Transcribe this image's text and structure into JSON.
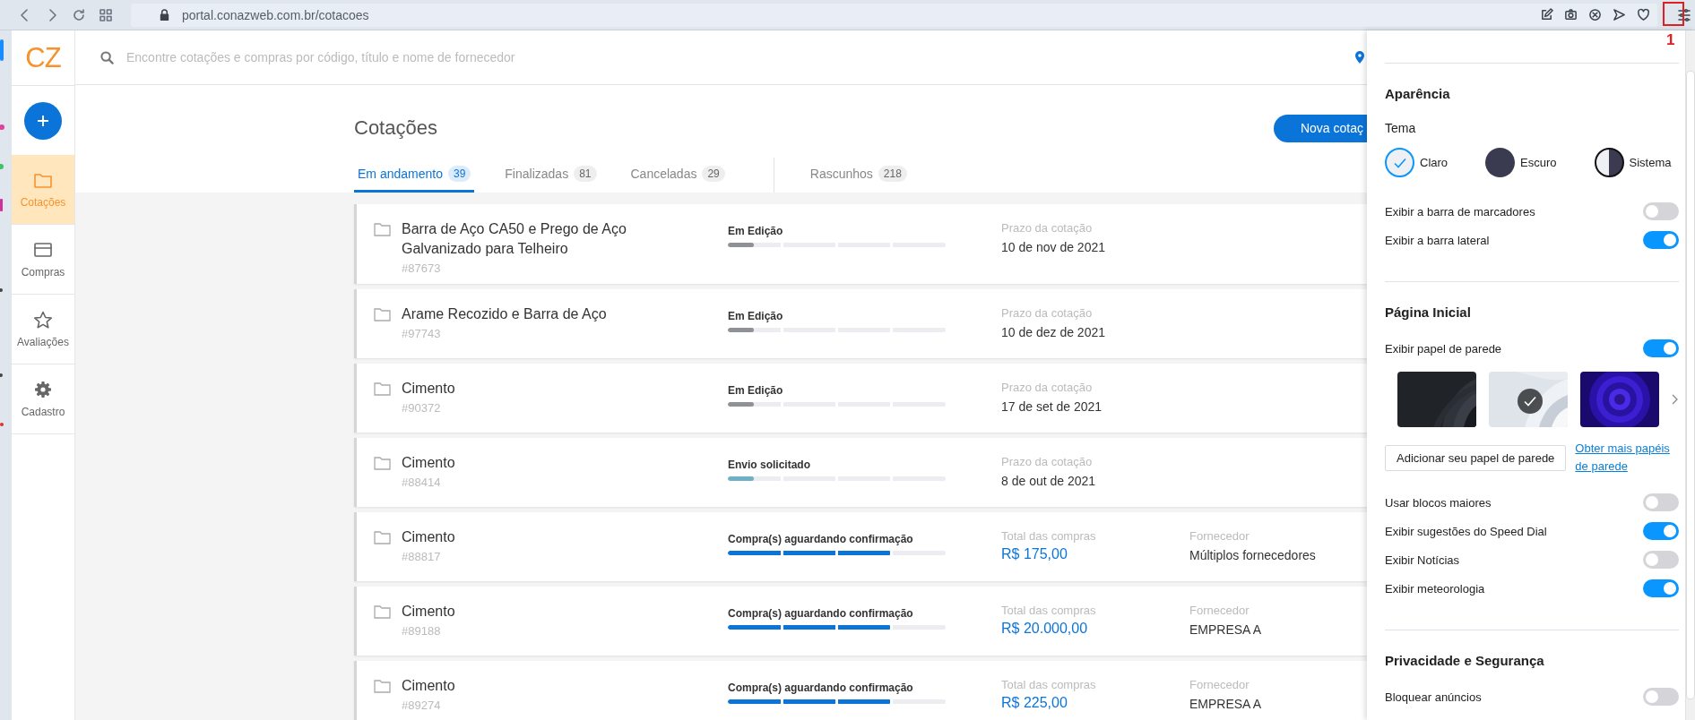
{
  "browser": {
    "url": "portal.conazweb.com.br/cotacoes"
  },
  "annotation": {
    "label": "1"
  },
  "app": {
    "logo": "CZ",
    "search": {
      "placeholder": "Encontre cotações e compras por código, título e nome de fornecedor"
    },
    "nav": [
      {
        "label": "Cotações",
        "selected": true
      },
      {
        "label": "Compras",
        "selected": false
      },
      {
        "label": "Avaliações",
        "selected": false
      },
      {
        "label": "Cadastro",
        "selected": false
      }
    ],
    "title": "Cotações",
    "new_button": "Nova cotaç",
    "tabs": [
      {
        "label": "Em andamento",
        "count": "39",
        "selected": true
      },
      {
        "label": "Finalizadas",
        "count": "81",
        "selected": false
      },
      {
        "label": "Canceladas",
        "count": "29",
        "selected": false
      },
      {
        "label": "Rascunhos",
        "count": "218",
        "selected": false
      }
    ],
    "cards": [
      {
        "kind": "deadline",
        "title": "Barra de Aço CA50 e Prego de Aço Galvanizado para Telheiro",
        "id": "#87673",
        "status": "Em Edição",
        "progress": {
          "level": 0.12,
          "color": "#8e9296"
        },
        "detail_label": "Prazo da cotação",
        "detail_value": "10 de nov de 2021"
      },
      {
        "kind": "deadline",
        "title": "Arame Recozido e Barra de Aço",
        "id": "#97743",
        "status": "Em Edição",
        "progress": {
          "level": 0.12,
          "color": "#8e9296"
        },
        "detail_label": "Prazo da cotação",
        "detail_value": "10 de dez de 2021"
      },
      {
        "kind": "deadline",
        "title": "Cimento",
        "id": "#90372",
        "status": "Em Edição",
        "progress": {
          "level": 0.12,
          "color": "#8e9296"
        },
        "detail_label": "Prazo da cotação",
        "detail_value": "17 de set de 2021"
      },
      {
        "kind": "deadline",
        "title": "Cimento",
        "id": "#88414",
        "status": "Envio solicitado",
        "progress": {
          "level": 0.12,
          "color": "#6fb0c4"
        },
        "detail_label": "Prazo da cotação",
        "detail_value": "8 de out de 2021"
      },
      {
        "kind": "purchase",
        "title": "Cimento",
        "id": "#88817",
        "status": "Compra(s) aguardando confirmação",
        "progress": {
          "level": 0.75,
          "color": "#0b74d8"
        },
        "detail_label": "Total das compras",
        "detail_value": "R$ 175,00",
        "supplier_label": "Fornecedor",
        "supplier": "Múltiplos fornecedores"
      },
      {
        "kind": "purchase",
        "title": "Cimento",
        "id": "#89188",
        "status": "Compra(s) aguardando confirmação",
        "progress": {
          "level": 0.75,
          "color": "#0b74d8"
        },
        "detail_label": "Total das compras",
        "detail_value": "R$ 20.000,00",
        "supplier_label": "Fornecedor",
        "supplier": "EMPRESA A"
      },
      {
        "kind": "purchase",
        "title": "Cimento",
        "id": "#89274",
        "status": "Compra(s) aguardando confirmação",
        "progress": {
          "level": 0.75,
          "color": "#0b74d8"
        },
        "detail_label": "Total das compras",
        "detail_value": "R$ 225,00",
        "supplier_label": "Fornecedor",
        "supplier": "EMPRESA A"
      }
    ]
  },
  "settings": {
    "sections": [
      {
        "title": "Aparência",
        "items": [
          {
            "kind": "theme",
            "label": "Tema",
            "options": [
              {
                "kind": "light",
                "label": "Claro",
                "selected": true
              },
              {
                "kind": "dark",
                "label": "Escuro",
                "selected": false
              },
              {
                "kind": "system",
                "label": "Sistema",
                "selected": false
              }
            ]
          },
          {
            "kind": "toggle",
            "label": "Exibir a barra de marcadores",
            "on": false
          },
          {
            "kind": "toggle",
            "label": "Exibir a barra lateral",
            "on": true
          }
        ]
      },
      {
        "title": "Página Inicial",
        "items": [
          {
            "kind": "toggle",
            "label": "Exibir papel de parede",
            "on": true
          },
          {
            "kind": "wallpapers",
            "options": [
              {
                "kind": "picture",
                "selected": false
              },
              {
                "kind": "picture",
                "selected": true
              },
              {
                "kind": "picture",
                "selected": false
              }
            ]
          },
          {
            "kind": "actions",
            "button": "Adicionar seu papel de parede",
            "link": "Obter mais papéis de parede"
          },
          {
            "kind": "toggle",
            "label": "Usar blocos maiores",
            "on": false
          },
          {
            "kind": "toggle",
            "label": "Exibir sugestões do Speed Dial",
            "on": true
          },
          {
            "kind": "toggle",
            "label": "Exibir Notícias",
            "on": false
          },
          {
            "kind": "toggle",
            "label": "Exibir meteorologia",
            "on": true
          }
        ]
      },
      {
        "title": "Privacidade e Segurança",
        "items": [
          {
            "kind": "toggle",
            "label": "Bloquear anúncios",
            "on": false
          }
        ]
      }
    ]
  }
}
